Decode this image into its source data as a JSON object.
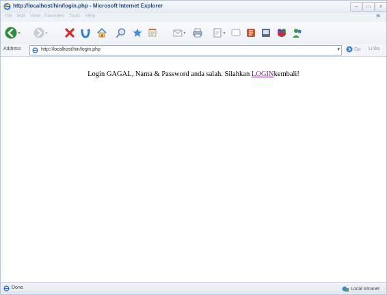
{
  "window": {
    "title": "http://localhost/hin/login.php - Microsoft Internet Explorer",
    "controls": [
      "–",
      "□",
      "×"
    ]
  },
  "menu": {
    "items": [
      "File",
      "Edit",
      "View",
      "Favorites",
      "Tools",
      "Help"
    ]
  },
  "address_bar": {
    "label": "Address",
    "url": "http://localhost/hin/login.php",
    "go_label": "Go",
    "links_label": "Links"
  },
  "page": {
    "message_before": "Login GAGAL, Nama & Password anda salah. Silahkan ",
    "link_text": "LOGIN",
    "message_after": "kembali!"
  },
  "status_bar": {
    "status": "Done",
    "zone": "Local intranet"
  },
  "colors": {
    "title_text": "#294a8c",
    "visited_link": "#7a1f8c"
  }
}
